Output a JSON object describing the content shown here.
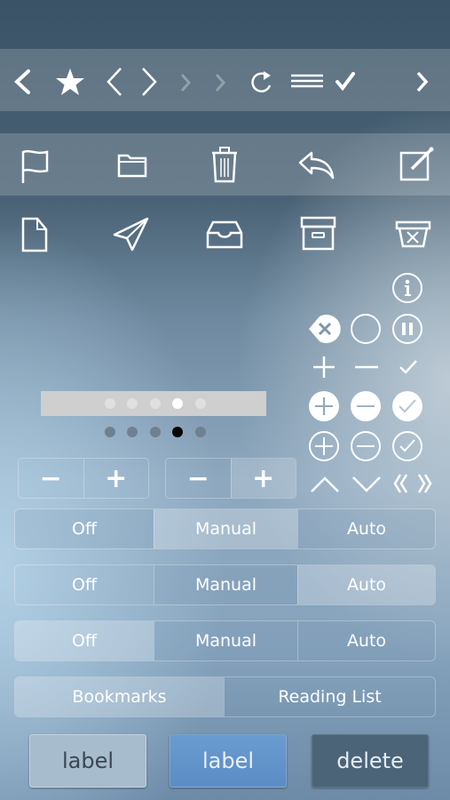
{
  "toolbar_top": {
    "icons": [
      "chevron-left",
      "star",
      "chevron-left-thin",
      "chevron-right-thin",
      "chevron-right-faded",
      "chevron-right-faded",
      "refresh",
      "hamburger-menu",
      "checkmark",
      "chevron-right"
    ]
  },
  "toolbar_second": {
    "icons": [
      "flag",
      "folder",
      "trash",
      "reply",
      "compose"
    ]
  },
  "icon_row": {
    "icons": [
      "document",
      "send",
      "inbox-tray",
      "archive-box",
      "delete-box"
    ]
  },
  "circle_icons": {
    "icons": [
      "info",
      "clear-tag",
      "empty-circle",
      "pause",
      "plus",
      "minus",
      "check",
      "plus-filled",
      "minus-filled",
      "check-filled",
      "plus-outline",
      "minus-outline",
      "check-outline",
      "chevron-up",
      "chevron-down",
      "double-chevrons"
    ]
  },
  "page_control": {
    "total": 5,
    "current": 4
  },
  "steppers": [
    {
      "minus": "−",
      "plus": "+",
      "highlighted": "none"
    },
    {
      "minus": "−",
      "plus": "+",
      "highlighted": "plus"
    }
  ],
  "segmented_controls": [
    {
      "options": [
        "Off",
        "Manual",
        "Auto"
      ],
      "selected": "Manual"
    },
    {
      "options": [
        "Off",
        "Manual",
        "Auto"
      ],
      "selected": "Auto"
    },
    {
      "options": [
        "Off",
        "Manual",
        "Auto"
      ],
      "selected": "Off"
    }
  ],
  "bookmarks_control": {
    "options": [
      "Bookmarks",
      "Reading List"
    ],
    "selected": "Bookmarks"
  },
  "buttons": {
    "light_label": "label",
    "blue_label": "label",
    "delete_label": "delete"
  },
  "colors": {
    "button_blue": "#5f91c8",
    "button_dark": "#4b6478",
    "page_dot_active": "#050505"
  }
}
